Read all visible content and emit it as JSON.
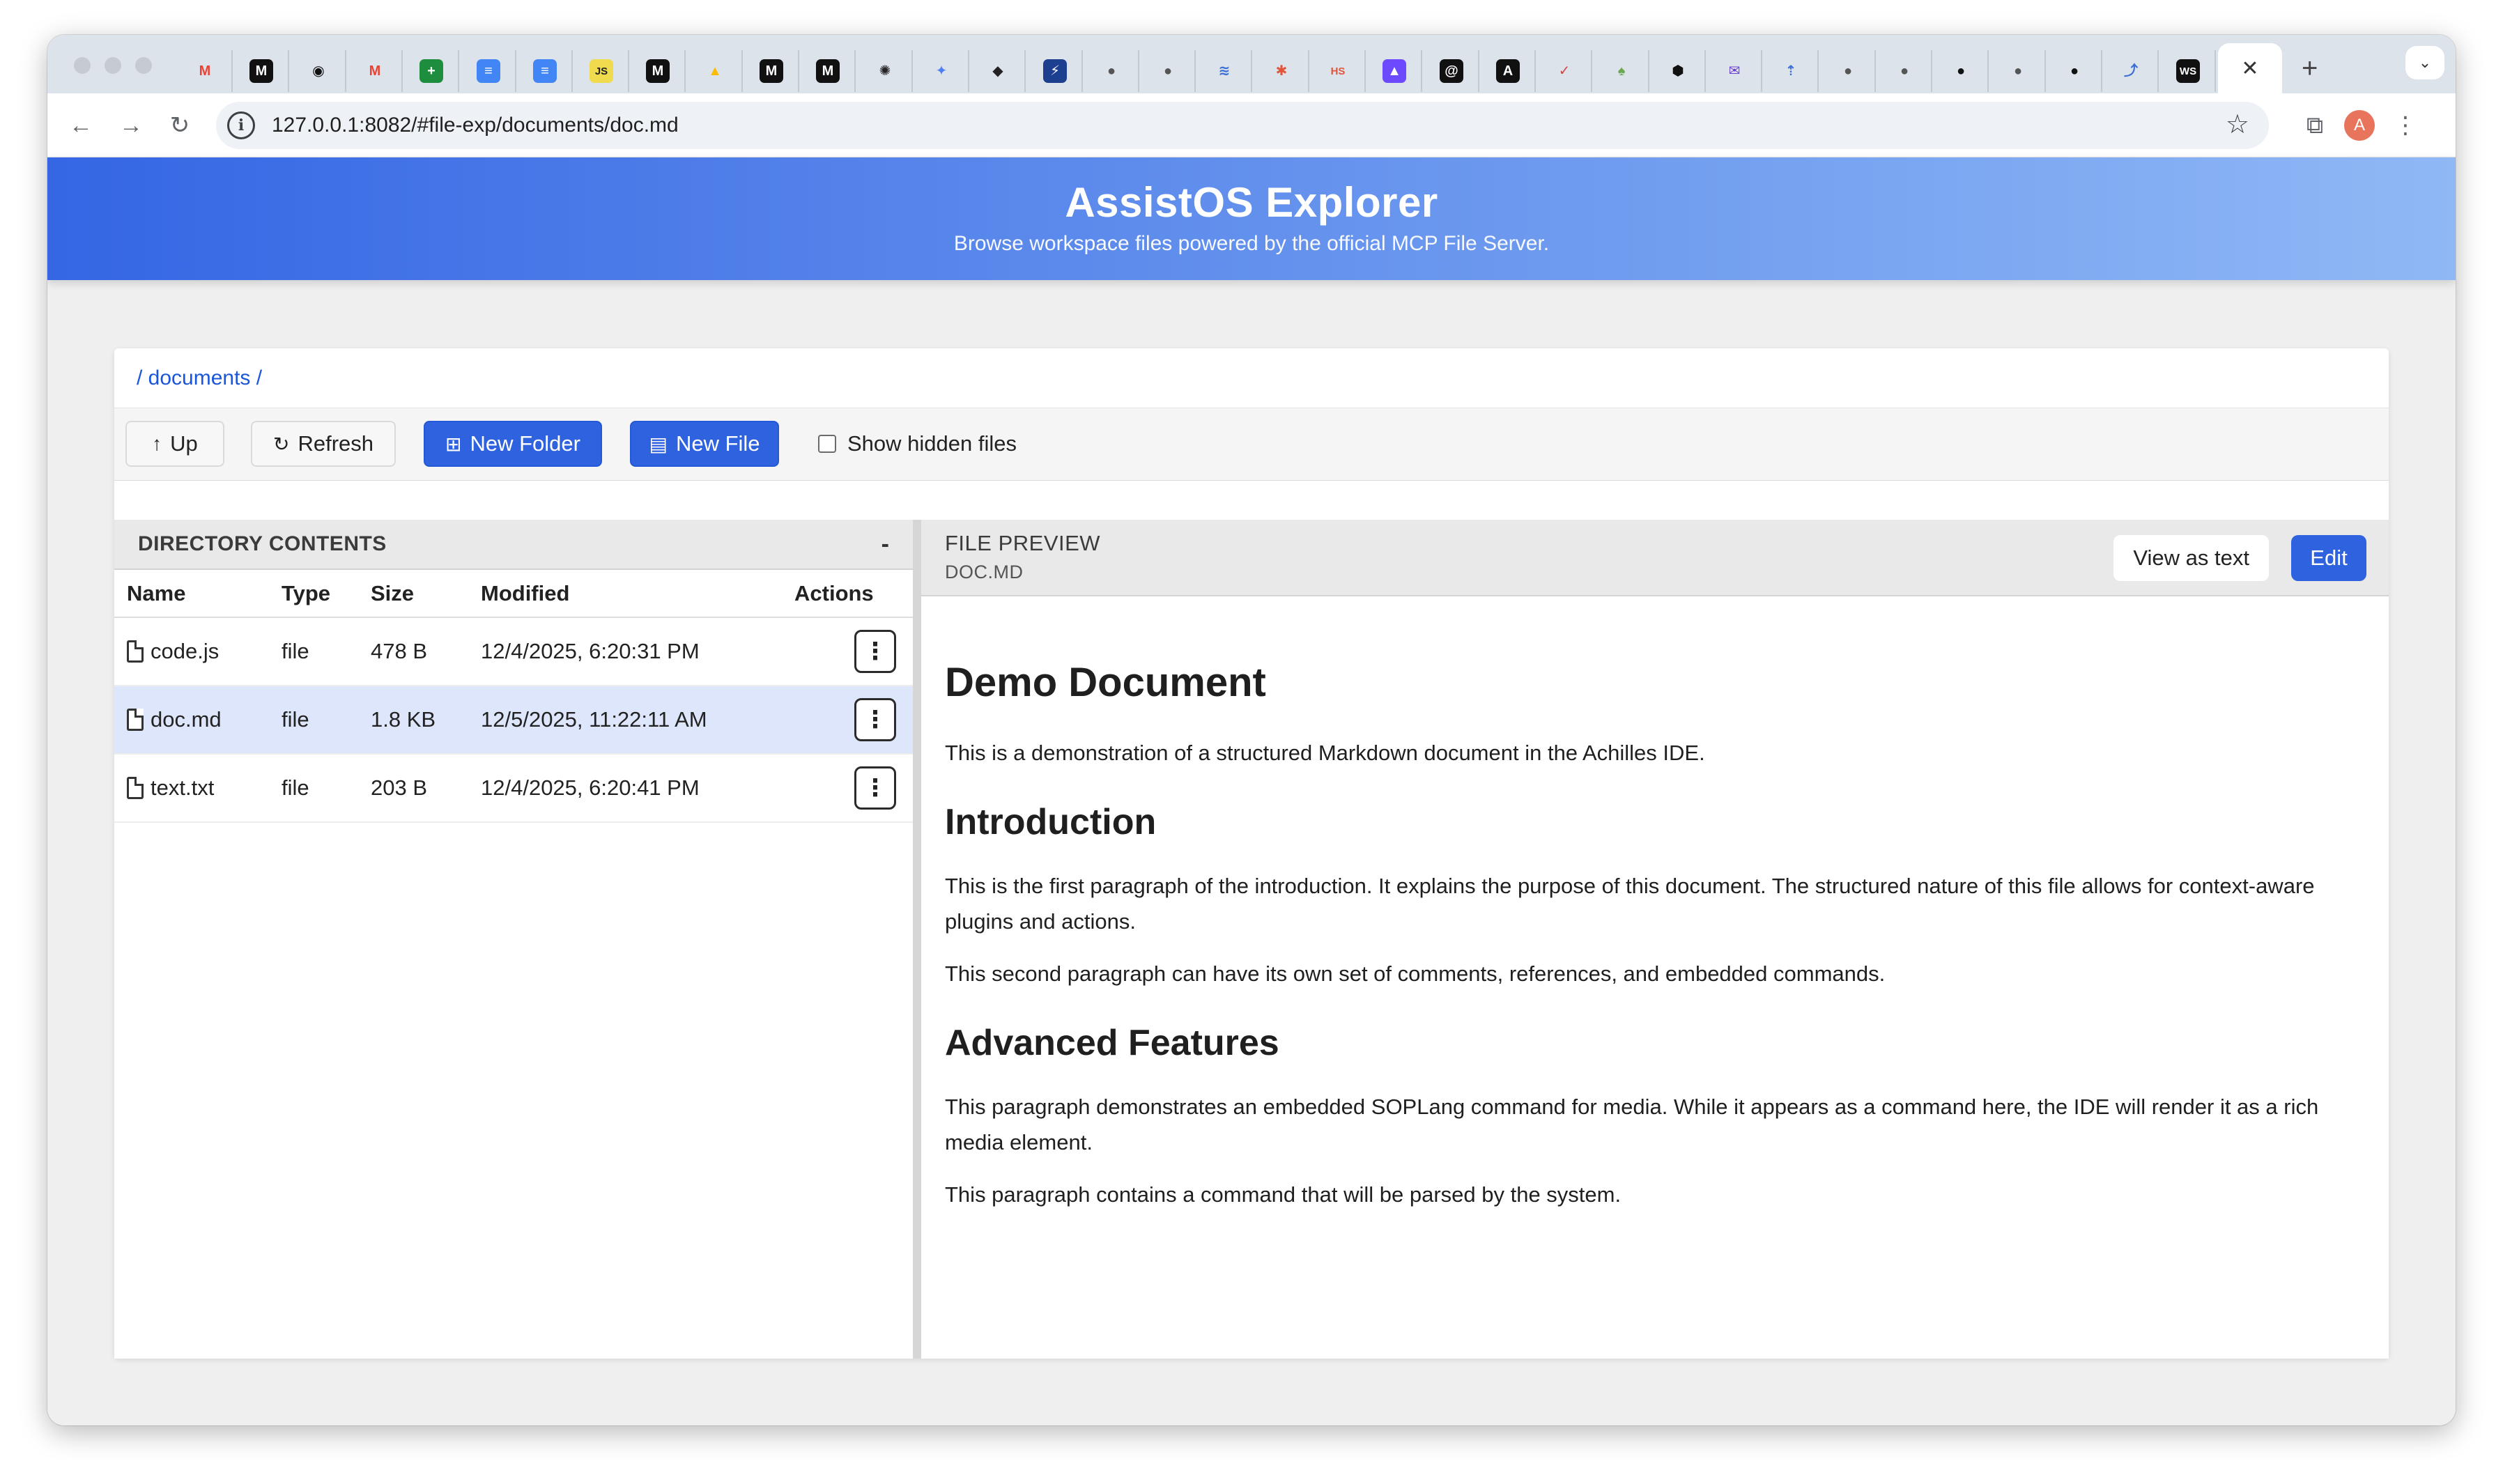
{
  "browser": {
    "tabs": [
      {
        "icon": "gmail-icon",
        "glyph": "M",
        "color": "#ea4335",
        "bg": "transparent",
        "fg": "#ea4335"
      },
      {
        "icon": "medium-icon",
        "glyph": "M",
        "bg": "#111111",
        "fg": "#ffffff"
      },
      {
        "icon": "chatgpt-icon",
        "glyph": "◉",
        "bg": "transparent",
        "fg": "#111111"
      },
      {
        "icon": "gmail-icon",
        "glyph": "M",
        "bg": "transparent",
        "fg": "#ea4335"
      },
      {
        "icon": "sheets-icon",
        "glyph": "+",
        "bg": "#1e8e3e",
        "fg": "#ffffff"
      },
      {
        "icon": "docs-icon",
        "glyph": "≡",
        "bg": "#4285f4",
        "fg": "#ffffff"
      },
      {
        "icon": "docs-icon",
        "glyph": "≡",
        "bg": "#4285f4",
        "fg": "#ffffff"
      },
      {
        "icon": "js-icon",
        "glyph": "JS",
        "bg": "#f0db4f",
        "fg": "#222222"
      },
      {
        "icon": "medium-icon",
        "glyph": "M",
        "bg": "#111111",
        "fg": "#ffffff"
      },
      {
        "icon": "drive-icon",
        "glyph": "▲",
        "bg": "transparent",
        "fg": "#fbbc04"
      },
      {
        "icon": "medium-icon",
        "glyph": "M",
        "bg": "#111111",
        "fg": "#ffffff"
      },
      {
        "icon": "medium-icon",
        "glyph": "M",
        "bg": "#111111",
        "fg": "#ffffff"
      },
      {
        "icon": "openai-icon",
        "glyph": "✺",
        "bg": "transparent",
        "fg": "#222222"
      },
      {
        "icon": "gemini-icon",
        "glyph": "✦",
        "bg": "transparent",
        "fg": "#4f7df3"
      },
      {
        "icon": "graduation-cap-icon",
        "glyph": "◆",
        "bg": "transparent",
        "fg": "#222222"
      },
      {
        "icon": "bitbucket-icon",
        "glyph": "⚡",
        "bg": "#1d3f8f",
        "fg": "#ffffff"
      },
      {
        "icon": "globe-icon",
        "glyph": "●",
        "bg": "transparent",
        "fg": "#555555"
      },
      {
        "icon": "globe-icon",
        "glyph": "●",
        "bg": "transparent",
        "fg": "#555555"
      },
      {
        "icon": "wave-icon",
        "glyph": "≋",
        "bg": "transparent",
        "fg": "#3b6fd6"
      },
      {
        "icon": "asterisk-icon",
        "glyph": "✱",
        "bg": "transparent",
        "fg": "#e2553b"
      },
      {
        "icon": "hs-icon",
        "glyph": "HS",
        "bg": "transparent",
        "fg": "#e2553b"
      },
      {
        "icon": "proton-icon",
        "glyph": "▲",
        "bg": "#6d4aff",
        "fg": "#ffffff"
      },
      {
        "icon": "at-icon",
        "glyph": "@",
        "bg": "#111111",
        "fg": "#ffffff"
      },
      {
        "icon": "anthropic-icon",
        "glyph": "A",
        "bg": "#111111",
        "fg": "#ffffff"
      },
      {
        "icon": "check-icon",
        "glyph": "✓",
        "bg": "transparent",
        "fg": "#d64545"
      },
      {
        "icon": "bird-icon",
        "glyph": "♠",
        "bg": "transparent",
        "fg": "#6aa84f"
      },
      {
        "icon": "cube-icon",
        "glyph": "⬢",
        "bg": "transparent",
        "fg": "#111111"
      },
      {
        "icon": "mail-icon",
        "glyph": "✉",
        "bg": "transparent",
        "fg": "#6d3fd0"
      },
      {
        "icon": "arrow-icon",
        "glyph": "⇡",
        "bg": "transparent",
        "fg": "#3b6fd6"
      },
      {
        "icon": "globe-icon",
        "glyph": "●",
        "bg": "transparent",
        "fg": "#555555"
      },
      {
        "icon": "globe-icon",
        "glyph": "●",
        "bg": "transparent",
        "fg": "#555555"
      },
      {
        "icon": "github-icon",
        "glyph": "●",
        "bg": "transparent",
        "fg": "#111111"
      },
      {
        "icon": "globe-icon",
        "glyph": "●",
        "bg": "transparent",
        "fg": "#555555"
      },
      {
        "icon": "github-icon",
        "glyph": "●",
        "bg": "transparent",
        "fg": "#111111"
      },
      {
        "icon": "link-icon",
        "glyph": "⤴",
        "bg": "transparent",
        "fg": "#3b6fd6"
      },
      {
        "icon": "webstorm-icon",
        "glyph": "WS",
        "bg": "#111111",
        "fg": "#ffffff"
      }
    ],
    "active_tab_close": "✕",
    "new_tab": "+",
    "url": "127.0.0.1:8082/#file-exp/documents/doc.md",
    "avatar_letter": "A"
  },
  "header": {
    "title": "AssistOS Explorer",
    "subtitle": "Browse workspace files powered by the official MCP File Server."
  },
  "breadcrumb": "/ documents /",
  "toolbar": {
    "up": "Up",
    "refresh": "Refresh",
    "new_folder": "New Folder",
    "new_file": "New File",
    "show_hidden": "Show hidden files"
  },
  "directory": {
    "title": "DIRECTORY CONTENTS",
    "collapse": "-",
    "columns": [
      "Name",
      "Type",
      "Size",
      "Modified",
      "Actions"
    ],
    "rows": [
      {
        "name": "code.js",
        "type": "file",
        "size": "478 B",
        "modified": "12/4/2025, 6:20:31 PM",
        "selected": false
      },
      {
        "name": "doc.md",
        "type": "file",
        "size": "1.8 KB",
        "modified": "12/5/2025, 11:22:11 AM",
        "selected": true
      },
      {
        "name": "text.txt",
        "type": "file",
        "size": "203 B",
        "modified": "12/4/2025, 6:20:41 PM",
        "selected": false
      }
    ]
  },
  "preview": {
    "title": "FILE PREVIEW",
    "file": "DOC.MD",
    "view_as_text": "View as text",
    "edit": "Edit",
    "h1": "Demo Document",
    "intro_p": "This is a demonstration of a structured Markdown document in the Achilles IDE.",
    "h2_intro": "Introduction",
    "p1": "This is the first paragraph of the introduction. It explains the purpose of this document. The structured nature of this file allows for context-aware plugins and actions.",
    "p2": "This second paragraph can have its own set of comments, references, and embedded commands.",
    "h2_adv": "Advanced Features",
    "p3": "This paragraph demonstrates an embedded SOPLang command for media. While it appears as a command here, the IDE will render it as a rich media element.",
    "p4": "This paragraph contains a command that will be parsed by the system."
  }
}
